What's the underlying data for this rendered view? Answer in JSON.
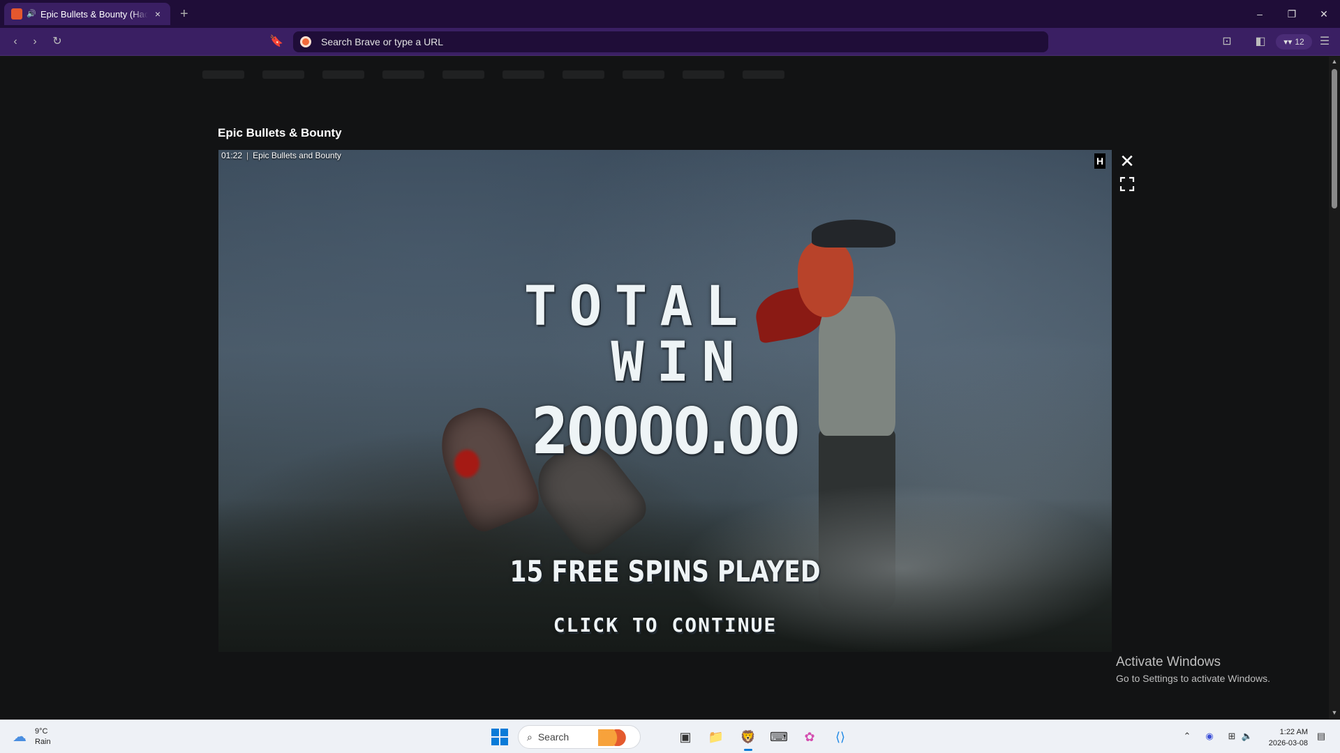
{
  "browser": {
    "tab_title": "Epic Bullets & Bounty (Hacksaw",
    "tab_close": "×",
    "new_tab": "+",
    "url_placeholder": "Search Brave or type a URL",
    "wallet_count": "12",
    "window_controls": {
      "minimize": "–",
      "maximize": "❐",
      "close": "✕"
    }
  },
  "modal": {
    "title": "Epic Bullets & Bounty",
    "close": "✕",
    "game": {
      "time": "01:22",
      "separator": "|",
      "name": "Epic Bullets and Bounty",
      "logo": "H",
      "total_label": "TOTAL",
      "win_label": "WIN",
      "amount": "20000.00",
      "spins_text": "15 FREE SPINS PLAYED",
      "continue_text": "CLICK TO CONTINUE"
    }
  },
  "watermark": {
    "line1": "Activate Windows",
    "line2": "Go to Settings to activate Windows."
  },
  "taskbar": {
    "weather_temp": "9°C",
    "weather_desc": "Rain",
    "search_placeholder": "Search",
    "time": "1:22 AM",
    "date": "2026-03-08"
  },
  "colors": {
    "titlebar": "#1f0d38",
    "toolbar": "#3a1f63",
    "page_bg": "#121314",
    "taskbar": "#eef1f6",
    "accent": "#0a7bd8"
  }
}
